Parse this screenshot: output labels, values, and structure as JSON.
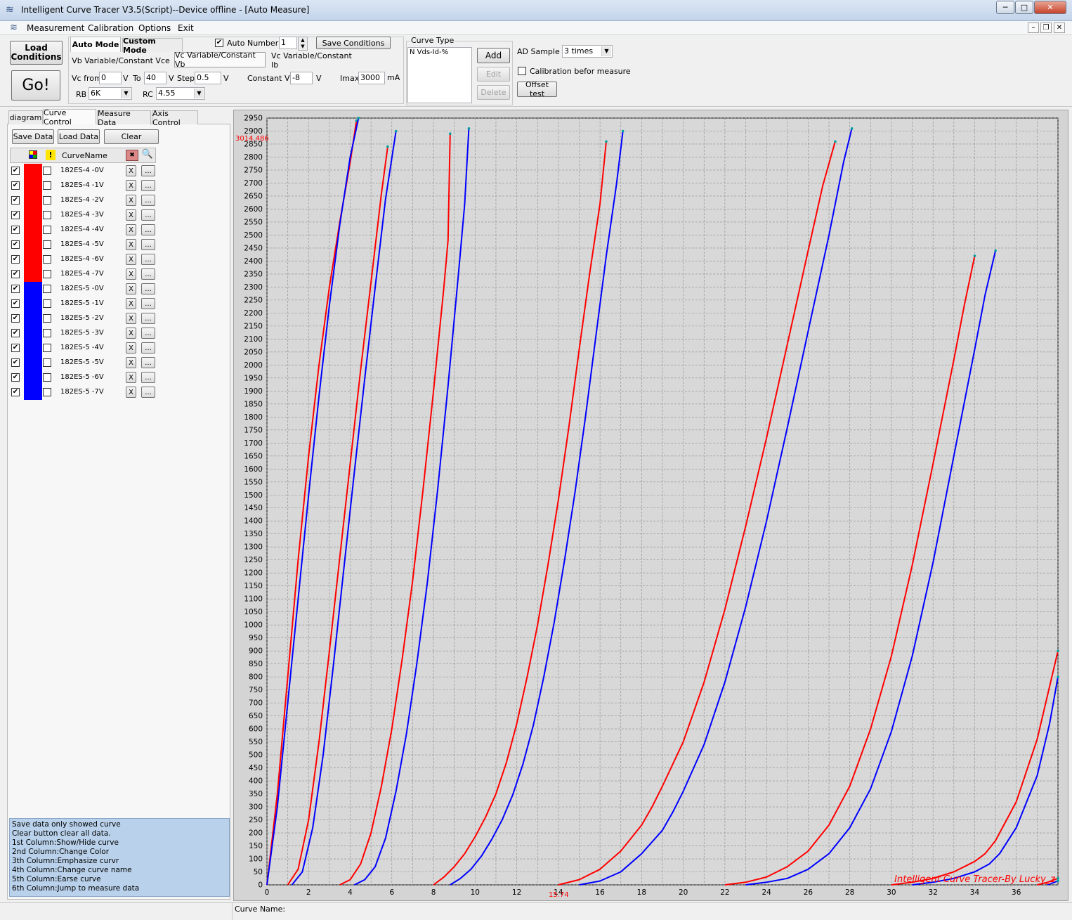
{
  "window": {
    "title": "Intelligent Curve Tracer V3.5(Script)--Device offline - [Auto Measure]",
    "min_glyph": "─",
    "max_glyph": "□",
    "close_glyph": "✕",
    "mdi_min_glyph": "–",
    "mdi_restore_glyph": "❐",
    "mdi_close_glyph": "✕"
  },
  "menu": {
    "measurement": "Measurement",
    "calibration": "Calibration",
    "options": "Options",
    "exit": "Exit"
  },
  "toolbar": {
    "load_conditions_line1": "Load",
    "load_conditions_line2": "Conditions",
    "go_label": "Go!",
    "auto_mode_tab": "Auto Mode",
    "custom_mode_tab": "Custom Mode",
    "auto_number_label": "Auto Number",
    "auto_number_checked": true,
    "auto_number_value": "1",
    "save_conditions": "Save Conditions",
    "mode_tab_1": "Vb Variable/Constant Vce",
    "mode_tab_2": "Vc Variable/Constant Vb",
    "mode_tab_3": "Vc Variable/Constant Ib",
    "vc_from_label": "Vc from",
    "vc_from_value": "0",
    "v_unit_1": "V",
    "to_label": "To",
    "to_value": "40",
    "v_unit_2": "V",
    "step_label": "Step",
    "step_value": "0.5",
    "v_unit_3": "V",
    "constant_vb_label": "Constant Vb",
    "constant_vb_value": "-8",
    "v_unit_4": "V",
    "imax_label": "Imax",
    "imax_value": "3000",
    "ma_unit": "mA",
    "rb_label": "RB",
    "rb_value": "6K",
    "rc_label": "RC",
    "rc_value": "4.55"
  },
  "curve_type": {
    "group_label": "Curve Type",
    "items": [
      "N Vds-Id-%"
    ],
    "add": "Add",
    "edit": "Edit",
    "delete": "Delete"
  },
  "ad_sample": {
    "label": "AD Sample",
    "value": "3 times",
    "calibration_label": "Calibration befor measure",
    "calibration_checked": false,
    "offset_test": "Offset test"
  },
  "left_tabs": [
    "diagram",
    "Curve Control",
    "Measure Data",
    "Axis Control"
  ],
  "curve_control": {
    "save_data": "Save Data",
    "load_data": "Load Data",
    "clear": "Clear",
    "header_name": "CurveName",
    "curves": [
      {
        "name": "182ES-4 -0V",
        "color": "#ff0000",
        "shown": true
      },
      {
        "name": "182ES-4 -1V",
        "color": "#ff0000",
        "shown": true
      },
      {
        "name": "182ES-4 -2V",
        "color": "#ff0000",
        "shown": true
      },
      {
        "name": "182ES-4 -3V",
        "color": "#ff0000",
        "shown": true
      },
      {
        "name": "182ES-4 -4V",
        "color": "#ff0000",
        "shown": true
      },
      {
        "name": "182ES-4 -5V",
        "color": "#ff0000",
        "shown": true
      },
      {
        "name": "182ES-4 -6V",
        "color": "#ff0000",
        "shown": true
      },
      {
        "name": "182ES-4 -7V",
        "color": "#ff0000",
        "shown": true
      },
      {
        "name": "182ES-5 -0V",
        "color": "#0000ff",
        "shown": true
      },
      {
        "name": "182ES-5 -1V",
        "color": "#0000ff",
        "shown": true
      },
      {
        "name": "182ES-5 -2V",
        "color": "#0000ff",
        "shown": true
      },
      {
        "name": "182ES-5 -3V",
        "color": "#0000ff",
        "shown": true
      },
      {
        "name": "182ES-5 -4V",
        "color": "#0000ff",
        "shown": true
      },
      {
        "name": "182ES-5 -5V",
        "color": "#0000ff",
        "shown": true
      },
      {
        "name": "182ES-5 -6V",
        "color": "#0000ff",
        "shown": true
      },
      {
        "name": "182ES-5 -7V",
        "color": "#0000ff",
        "shown": true
      }
    ],
    "erase_glyph": "X",
    "jump_glyph": "..."
  },
  "help_lines": [
    "  Save data only showed curve",
    "  Clear button clear all data.",
    "1st Column:Show/Hide curve",
    "2nd Column:Change Color",
    "3th Column:Emphasize curvr",
    "4th Column:Change curve name",
    "5th Column:Earse curve",
    "6th Column:Jump to measure data"
  ],
  "status": {
    "curve_name_label": "Curve Name:"
  },
  "chart_data": {
    "type": "line",
    "xlim": [
      0,
      38
    ],
    "ylim": [
      0,
      2950
    ],
    "xticks": [
      0,
      2,
      4,
      6,
      8,
      10,
      12,
      14,
      16,
      18,
      20,
      22,
      24,
      26,
      28,
      30,
      32,
      34,
      36
    ],
    "yticks_step": 50,
    "grid": true,
    "cursor_x_label": "15.74",
    "cursor_y_label": "3014.486",
    "watermark": "Intelligent Curve Tracer-By Lucky_z",
    "series": [
      {
        "name": "182ES-4 -0V",
        "color": "#ff0000",
        "points": [
          [
            0,
            0
          ],
          [
            0.5,
            350
          ],
          [
            1,
            800
          ],
          [
            1.5,
            1250
          ],
          [
            2,
            1650
          ],
          [
            2.5,
            2000
          ],
          [
            3,
            2300
          ],
          [
            3.5,
            2550
          ],
          [
            4,
            2780
          ],
          [
            4.3,
            2940
          ]
        ]
      },
      {
        "name": "182ES-4 -1V",
        "color": "#ff0000",
        "points": [
          [
            1,
            0
          ],
          [
            1.5,
            60
          ],
          [
            2,
            250
          ],
          [
            2.5,
            550
          ],
          [
            3,
            900
          ],
          [
            3.5,
            1260
          ],
          [
            4,
            1620
          ],
          [
            4.5,
            1980
          ],
          [
            5,
            2320
          ],
          [
            5.5,
            2660
          ],
          [
            5.8,
            2840
          ]
        ]
      },
      {
        "name": "182ES-4 -2V",
        "color": "#ff0000",
        "points": [
          [
            3.5,
            0
          ],
          [
            4,
            20
          ],
          [
            4.5,
            80
          ],
          [
            5,
            200
          ],
          [
            5.5,
            380
          ],
          [
            6,
            600
          ],
          [
            6.5,
            870
          ],
          [
            7,
            1170
          ],
          [
            7.5,
            1520
          ],
          [
            8,
            1900
          ],
          [
            8.5,
            2300
          ],
          [
            8.7,
            2480
          ],
          [
            8.8,
            2890
          ]
        ]
      },
      {
        "name": "182ES-4 -3V",
        "color": "#ff0000",
        "points": [
          [
            8,
            0
          ],
          [
            8.5,
            30
          ],
          [
            9,
            70
          ],
          [
            9.5,
            120
          ],
          [
            10,
            185
          ],
          [
            10.5,
            260
          ],
          [
            11,
            350
          ],
          [
            11.5,
            470
          ],
          [
            12,
            620
          ],
          [
            12.5,
            800
          ],
          [
            13,
            1000
          ],
          [
            13.5,
            1230
          ],
          [
            14,
            1480
          ],
          [
            14.5,
            1760
          ],
          [
            15,
            2060
          ],
          [
            15.5,
            2350
          ],
          [
            16,
            2620
          ],
          [
            16.3,
            2860
          ]
        ]
      },
      {
        "name": "182ES-4 -4V",
        "color": "#ff0000",
        "points": [
          [
            14,
            0
          ],
          [
            15,
            20
          ],
          [
            16,
            60
          ],
          [
            17,
            130
          ],
          [
            18,
            230
          ],
          [
            18.5,
            300
          ],
          [
            19,
            380
          ],
          [
            20,
            550
          ],
          [
            21,
            780
          ],
          [
            22,
            1060
          ],
          [
            23,
            1380
          ],
          [
            24,
            1720
          ],
          [
            25,
            2080
          ],
          [
            26,
            2440
          ],
          [
            26.7,
            2690
          ],
          [
            27.3,
            2860
          ]
        ]
      },
      {
        "name": "182ES-4 -5V",
        "color": "#ff0000",
        "points": [
          [
            22,
            0
          ],
          [
            23,
            10
          ],
          [
            24,
            30
          ],
          [
            25,
            70
          ],
          [
            26,
            130
          ],
          [
            27,
            230
          ],
          [
            28,
            380
          ],
          [
            29,
            600
          ],
          [
            30,
            880
          ],
          [
            31,
            1230
          ],
          [
            32,
            1620
          ],
          [
            33,
            2020
          ],
          [
            33.5,
            2230
          ],
          [
            34,
            2420
          ]
        ]
      },
      {
        "name": "182ES-4 -6V",
        "color": "#ff0000",
        "points": [
          [
            30,
            0
          ],
          [
            31,
            10
          ],
          [
            32,
            25
          ],
          [
            33,
            50
          ],
          [
            34,
            90
          ],
          [
            34.5,
            120
          ],
          [
            35,
            170
          ],
          [
            36,
            320
          ],
          [
            37,
            560
          ],
          [
            37.5,
            730
          ],
          [
            38,
            900
          ]
        ]
      },
      {
        "name": "182ES-4 -7V",
        "color": "#ff0000",
        "points": [
          [
            37,
            0
          ],
          [
            37.5,
            10
          ],
          [
            38,
            25
          ]
        ]
      },
      {
        "name": "182ES-5 -0V",
        "color": "#0000ff",
        "points": [
          [
            0,
            0
          ],
          [
            0.5,
            300
          ],
          [
            1,
            700
          ],
          [
            1.5,
            1100
          ],
          [
            2,
            1500
          ],
          [
            2.5,
            1880
          ],
          [
            3,
            2230
          ],
          [
            3.5,
            2540
          ],
          [
            4,
            2800
          ],
          [
            4.4,
            2960
          ]
        ]
      },
      {
        "name": "182ES-5 -1V",
        "color": "#0000ff",
        "points": [
          [
            1.2,
            0
          ],
          [
            1.7,
            50
          ],
          [
            2.2,
            220
          ],
          [
            2.7,
            500
          ],
          [
            3.2,
            850
          ],
          [
            3.7,
            1220
          ],
          [
            4.2,
            1590
          ],
          [
            4.7,
            1950
          ],
          [
            5.2,
            2300
          ],
          [
            5.7,
            2640
          ],
          [
            6.2,
            2900
          ]
        ]
      },
      {
        "name": "182ES-5 -2V",
        "color": "#0000ff",
        "points": [
          [
            4.2,
            0
          ],
          [
            4.7,
            20
          ],
          [
            5.2,
            70
          ],
          [
            5.7,
            180
          ],
          [
            6.2,
            360
          ],
          [
            6.7,
            580
          ],
          [
            7.2,
            850
          ],
          [
            7.7,
            1160
          ],
          [
            8.2,
            1520
          ],
          [
            8.7,
            1920
          ],
          [
            9.2,
            2350
          ],
          [
            9.5,
            2620
          ],
          [
            9.7,
            2910
          ]
        ]
      },
      {
        "name": "182ES-5 -3V",
        "color": "#0000ff",
        "points": [
          [
            8.8,
            0
          ],
          [
            9.3,
            25
          ],
          [
            9.8,
            60
          ],
          [
            10.3,
            110
          ],
          [
            10.8,
            175
          ],
          [
            11.3,
            250
          ],
          [
            11.8,
            345
          ],
          [
            12.3,
            465
          ],
          [
            12.8,
            615
          ],
          [
            13.3,
            800
          ],
          [
            13.8,
            1010
          ],
          [
            14.3,
            1250
          ],
          [
            14.8,
            1510
          ],
          [
            15.3,
            1800
          ],
          [
            15.8,
            2110
          ],
          [
            16.3,
            2420
          ],
          [
            16.8,
            2700
          ],
          [
            17.1,
            2900
          ]
        ]
      },
      {
        "name": "182ES-5 -4V",
        "color": "#0000ff",
        "points": [
          [
            15,
            0
          ],
          [
            16,
            15
          ],
          [
            17,
            50
          ],
          [
            18,
            120
          ],
          [
            19,
            210
          ],
          [
            19.5,
            280
          ],
          [
            20,
            360
          ],
          [
            21,
            540
          ],
          [
            22,
            780
          ],
          [
            23,
            1070
          ],
          [
            24,
            1400
          ],
          [
            25,
            1760
          ],
          [
            26,
            2130
          ],
          [
            27,
            2500
          ],
          [
            27.7,
            2780
          ],
          [
            28.1,
            2910
          ]
        ]
      },
      {
        "name": "182ES-5 -5V",
        "color": "#0000ff",
        "points": [
          [
            23,
            0
          ],
          [
            24,
            10
          ],
          [
            25,
            25
          ],
          [
            26,
            60
          ],
          [
            27,
            120
          ],
          [
            28,
            220
          ],
          [
            29,
            370
          ],
          [
            30,
            590
          ],
          [
            31,
            880
          ],
          [
            32,
            1240
          ],
          [
            33,
            1650
          ],
          [
            34,
            2060
          ],
          [
            34.5,
            2270
          ],
          [
            35,
            2440
          ]
        ]
      },
      {
        "name": "182ES-5 -6V",
        "color": "#0000ff",
        "points": [
          [
            31,
            0
          ],
          [
            32,
            10
          ],
          [
            33,
            25
          ],
          [
            34,
            50
          ],
          [
            34.7,
            80
          ],
          [
            35.2,
            120
          ],
          [
            36,
            220
          ],
          [
            37,
            420
          ],
          [
            37.6,
            620
          ],
          [
            38,
            800
          ]
        ]
      },
      {
        "name": "182ES-5 -7V",
        "color": "#0000ff",
        "points": [
          [
            37.5,
            0
          ],
          [
            38,
            15
          ]
        ]
      }
    ]
  }
}
